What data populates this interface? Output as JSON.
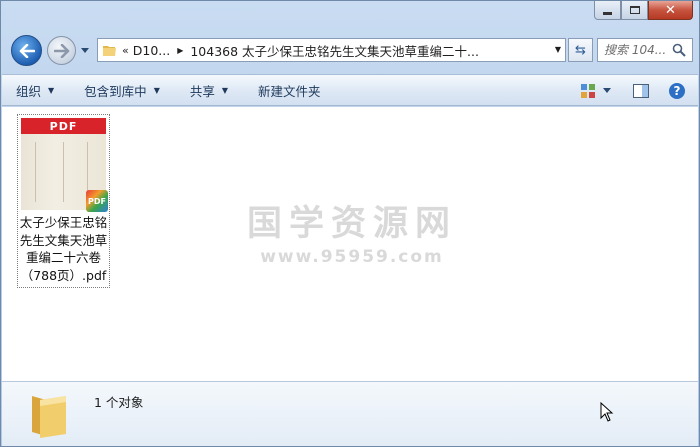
{
  "window": {
    "caption": {
      "minimize": "minimize",
      "maximize": "maximize",
      "close": "✕"
    }
  },
  "address": {
    "overflow": "«",
    "crumbs": [
      "D10...",
      "104368 太子少保王忠铭先生文集天池草重编二十..."
    ],
    "search_placeholder": "搜索 104..."
  },
  "toolbar": {
    "organize": "组织",
    "include_library": "包含到库中",
    "share": "共享",
    "new_folder": "新建文件夹"
  },
  "file": {
    "strip": "PDF",
    "badge": "PDF",
    "name": "太子少保王忠铭先生文集天池草重编二十六卷（788页）.pdf"
  },
  "watermark": {
    "title": "国学资源网",
    "url": "www.95959.com"
  },
  "details": {
    "count": "1 个对象"
  },
  "colors": {
    "pdf_red": "#d8232a",
    "toolbar_text": "#1e395b"
  }
}
